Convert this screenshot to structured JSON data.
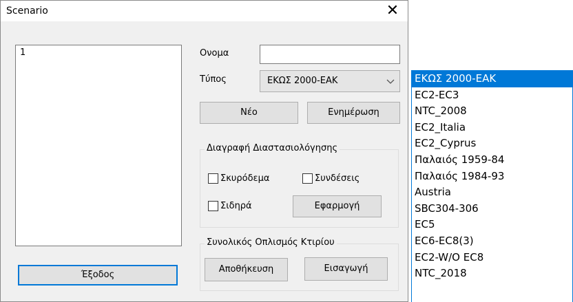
{
  "dialog": {
    "title": "Scenario",
    "close_glyph": "✕"
  },
  "scenario_list": {
    "items": [
      "1"
    ]
  },
  "form": {
    "name_label": "Ονομα",
    "name_value": "",
    "type_label": "Τύπος",
    "type_selected": "ΕΚΩΣ 2000-ΕΑΚ",
    "new_button": "Νέο",
    "update_button": "Ενημέρωση"
  },
  "delete_group": {
    "title": "Διαγραφή Διαστασιολόγησης",
    "concrete_label": "Σκυρόδεμα",
    "concrete_checked": false,
    "connections_label": "Συνδέσεις",
    "connections_checked": false,
    "steel_label": "Σιδηρά",
    "steel_checked": false,
    "apply_button": "Εφαρμογή"
  },
  "reinforcement_group": {
    "title": "Συνολικός Οπλισμός Κτιρίου",
    "save_button": "Αποθήκευση",
    "import_button": "Εισαγωγή"
  },
  "exit_button": "Έξοδος",
  "type_dropdown": {
    "options": [
      "ΕΚΩΣ 2000-ΕΑΚ",
      "EC2-EC3",
      "NTC_2008",
      "EC2_Italia",
      "EC2_Cyprus",
      "Παλαιός 1959-84",
      "Παλαιός 1984-93",
      "Austria",
      "SBC304-306",
      "EC5",
      "EC6-EC8(3)",
      "EC2-W/O EC8",
      "NTC_2018"
    ],
    "selected_index": 0
  },
  "colors": {
    "accent": "#0078d7",
    "dialog_bg": "#f0f0f0",
    "button_bg": "#e1e1e1"
  },
  "icons": {
    "combo_arrow": "chevron-down-icon",
    "close": "close-icon"
  }
}
